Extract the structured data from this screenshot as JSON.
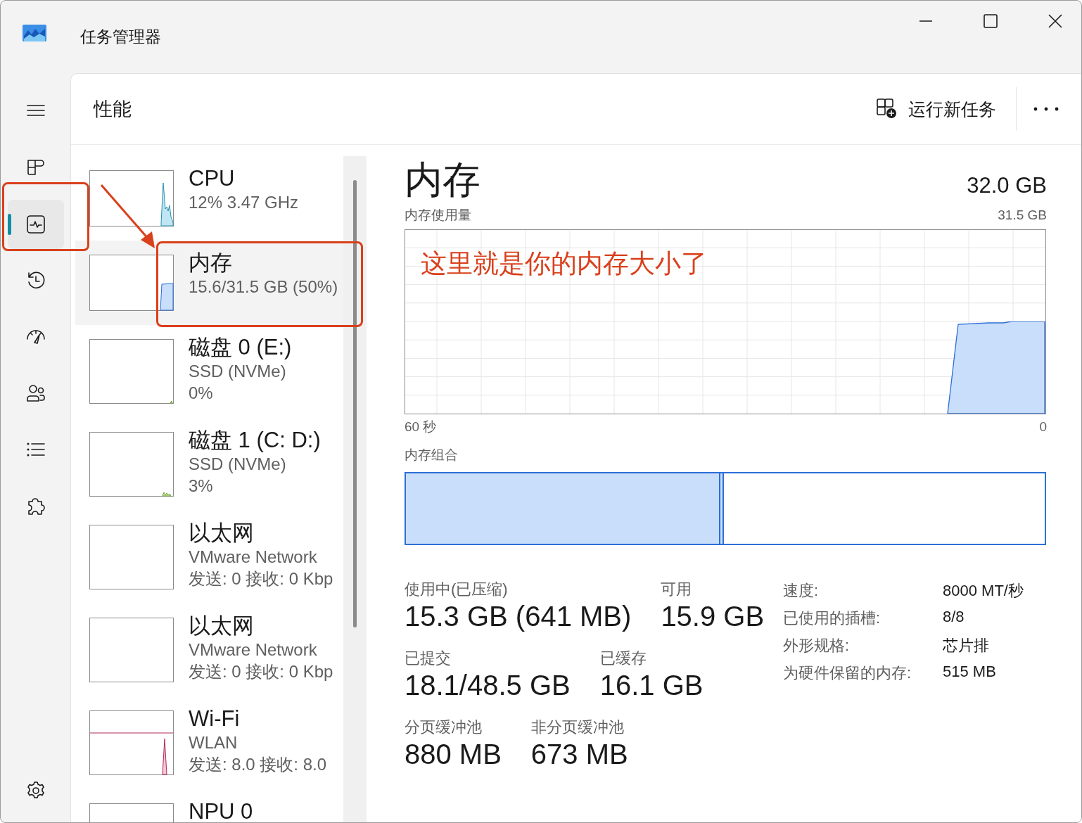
{
  "window": {
    "title": "任务管理器"
  },
  "nav": {
    "items": [
      {
        "kind": "menu",
        "selected": false
      },
      {
        "kind": "processes",
        "selected": false
      },
      {
        "kind": "performance",
        "selected": true
      },
      {
        "kind": "history",
        "selected": false
      },
      {
        "kind": "startup",
        "selected": false
      },
      {
        "kind": "users",
        "selected": false
      },
      {
        "kind": "details",
        "selected": false
      },
      {
        "kind": "services",
        "selected": false
      },
      {
        "kind": "settings",
        "selected": false
      }
    ]
  },
  "header": {
    "title": "性能",
    "run_task": "运行新任务"
  },
  "devices": [
    {
      "kind": "cpu",
      "selected": false,
      "name": "CPU",
      "lines": [
        "12%  3.47 GHz"
      ]
    },
    {
      "kind": "memory",
      "selected": true,
      "name": "内存",
      "lines": [
        "15.6/31.5 GB (50%)"
      ]
    },
    {
      "kind": "disk",
      "selected": false,
      "name": "磁盘 0 (E:)",
      "lines": [
        "SSD (NVMe)",
        "0%"
      ]
    },
    {
      "kind": "disk2",
      "selected": false,
      "name": "磁盘 1 (C: D:)",
      "lines": [
        "SSD (NVMe)",
        "3%"
      ]
    },
    {
      "kind": "network",
      "selected": false,
      "name": "以太网",
      "lines": [
        "VMware Network",
        "发送: 0 接收: 0 Kbp"
      ]
    },
    {
      "kind": "network",
      "selected": false,
      "name": "以太网",
      "lines": [
        "VMware Network",
        "发送: 0 接收: 0 Kbp"
      ]
    },
    {
      "kind": "wifi",
      "selected": false,
      "name": "Wi-Fi",
      "lines": [
        "WLAN",
        "发送: 8.0 接收: 8.0"
      ]
    },
    {
      "kind": "npu",
      "selected": false,
      "name": "NPU 0"
    }
  ],
  "detail": {
    "title": "内存",
    "total": "32.0 GB",
    "usage_label": "内存使用量",
    "usage_max": "31.5 GB",
    "annotation": "这里就是你的内存大小了",
    "x_start": "60 秒",
    "x_end": "0",
    "composition_label": "内存组合",
    "composition": [
      {
        "kind": "in_use",
        "level": 0.49
      }
    ],
    "stats": [
      [
        {
          "label": "使用中(已压缩)",
          "value": "15.3 GB (641 MB)"
        },
        {
          "label": "可用",
          "value": "15.9 GB"
        }
      ],
      [
        {
          "label": "已提交",
          "value": "18.1/48.5 GB"
        },
        {
          "label": "已缓存",
          "value": "16.1 GB"
        }
      ],
      [
        {
          "label": "分页缓冲池",
          "value": "880 MB"
        },
        {
          "label": "非分页缓冲池",
          "value": "673 MB"
        }
      ]
    ],
    "props": [
      {
        "label": "速度:",
        "value": "8000 MT/秒"
      },
      {
        "label": "已使用的插槽:",
        "value": "8/8"
      },
      {
        "label": "外形规格:",
        "value": "芯片排"
      },
      {
        "label": "为硬件保留的内存:",
        "value": "515 MB"
      }
    ]
  }
}
